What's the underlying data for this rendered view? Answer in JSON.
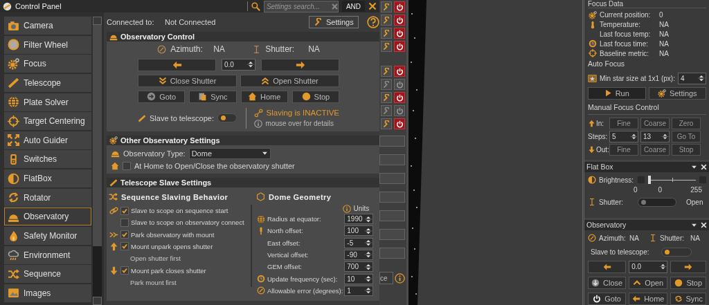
{
  "window": {
    "title": "Control Panel",
    "search": {
      "placeholder": "Settings search..."
    },
    "and_button": "AND"
  },
  "sidebar": {
    "items": [
      {
        "label": "Camera",
        "selected": false
      },
      {
        "label": "Filter Wheel",
        "selected": false
      },
      {
        "label": "Focus",
        "selected": false
      },
      {
        "label": "Telescope",
        "selected": false
      },
      {
        "label": "Plate Solver",
        "selected": false
      },
      {
        "label": "Target Centering",
        "selected": false
      },
      {
        "label": "Auto Guider",
        "selected": false
      },
      {
        "label": "Switches",
        "selected": false
      },
      {
        "label": "FlatBox",
        "selected": false
      },
      {
        "label": "Rotator",
        "selected": false
      },
      {
        "label": "Observatory",
        "selected": true
      },
      {
        "label": "Safety Monitor",
        "selected": false
      },
      {
        "label": "Environment",
        "selected": false
      },
      {
        "label": "Sequence",
        "selected": false
      },
      {
        "label": "Images",
        "selected": false
      }
    ]
  },
  "connection": {
    "label": "Connected to:",
    "value": "Not Connected",
    "settings_button": "Settings"
  },
  "observatory_control": {
    "title": "Observatory Control",
    "azimuth_label": "Azimuth:",
    "azimuth": "NA",
    "shutter_label": "Shutter:",
    "shutter": "NA",
    "step": "0.0",
    "close_shutter": "Close Shutter",
    "open_shutter": "Open Shutter",
    "buttons": [
      "Goto",
      "Sync",
      "Home",
      "Stop"
    ],
    "slave_label": "Slave to telescope:",
    "slave_on": false,
    "slaving_status": "Slaving is INACTIVE",
    "details_hint": "mouse over for details"
  },
  "other_settings": {
    "title": "Other Observatory Settings",
    "type_label": "Observatory Type:",
    "type_value": "Dome",
    "home_option": {
      "label": "At Home to Open/Close the observatory shutter",
      "checked": false
    }
  },
  "slave_settings": {
    "title": "Telescope Slave Settings",
    "sequence_title": "Sequence Slaving Behavior",
    "options": [
      {
        "kind": "checkbox",
        "label": "Slave to scope on sequence start",
        "checked": true
      },
      {
        "kind": "checkbox",
        "label": "Slave to scope on observatory connect",
        "checked": false
      },
      {
        "kind": "checkbox",
        "label": "Park observatory with mount",
        "checked": true
      },
      {
        "kind": "checkbox",
        "label": "Mount unpark opens shutter",
        "checked": true
      },
      {
        "kind": "note",
        "label": "Open shutter first"
      },
      {
        "kind": "checkbox",
        "label": "Mount park closes shutter",
        "checked": true
      },
      {
        "kind": "note",
        "label": "Park mount first"
      }
    ],
    "geometry_title": "Dome Geometry",
    "units_label": "Units",
    "geometry": [
      {
        "label": "Radius at equator:",
        "value": "1990"
      },
      {
        "label": "North offset:",
        "value": "100"
      },
      {
        "label": "East offset:",
        "value": "-5"
      },
      {
        "label": "Vertical offset:",
        "value": "-90"
      },
      {
        "label": "GEM offset:",
        "value": "700"
      },
      {
        "label": "Update frequency (sec):",
        "value": "10"
      },
      {
        "label": "Allowable error (degrees):",
        "value": "1"
      }
    ]
  },
  "device_buttons": [
    {
      "enabled": true
    },
    {
      "enabled": true
    },
    {
      "enabled": true
    },
    {
      "enabled": true
    },
    {
      "enabled": true
    },
    {
      "enabled": false
    },
    {
      "enabled": true
    },
    {
      "enabled": false
    },
    {
      "enabled": true
    }
  ],
  "device_field_text": "ce",
  "focus": {
    "title": "Focus Data",
    "rows": [
      {
        "label": "Current position:",
        "value": "0"
      },
      {
        "label": "Temperature:",
        "value": "NA"
      },
      {
        "label": "Last focus temp:",
        "value": "NA"
      },
      {
        "label": "Last focus time:",
        "value": "NA"
      },
      {
        "label": "Baseline metric:",
        "value": "NA"
      }
    ],
    "auto_focus_title": "Auto Focus",
    "min_star_label": "Min star size at 1x1 (px):",
    "min_star_value": "4",
    "run_button": "Run",
    "settings_button": "Settings",
    "manual_title": "Manual Focus Control",
    "in_label": "In:",
    "in_buttons": [
      "Fine",
      "Coarse",
      "Zero"
    ],
    "steps_label": "Steps:",
    "steps": [
      "5",
      "13"
    ],
    "goto_button": "Go To",
    "out_label": "Out:",
    "out_buttons": [
      "Fine",
      "Coarse",
      "Stop"
    ]
  },
  "flat_box": {
    "title": "Flat Box",
    "brightness_label": "Brightness:",
    "level": 0,
    "min": "0",
    "current": "0",
    "max": "255",
    "shutter_label": "Shutter:",
    "shutter_on": false,
    "shutter_value": "Open"
  },
  "observatory_panel": {
    "title": "Observatory",
    "azimuth_label": "Azimuth:",
    "azimuth": "NA",
    "shutter_label": "Shutter:",
    "shutter": "NA",
    "slave_label": "Slave to telescope:",
    "slave_on": false,
    "step": "0.0",
    "buttons": [
      "Close",
      "Open",
      "Stop",
      "Goto",
      "Home",
      "Sync"
    ]
  }
}
